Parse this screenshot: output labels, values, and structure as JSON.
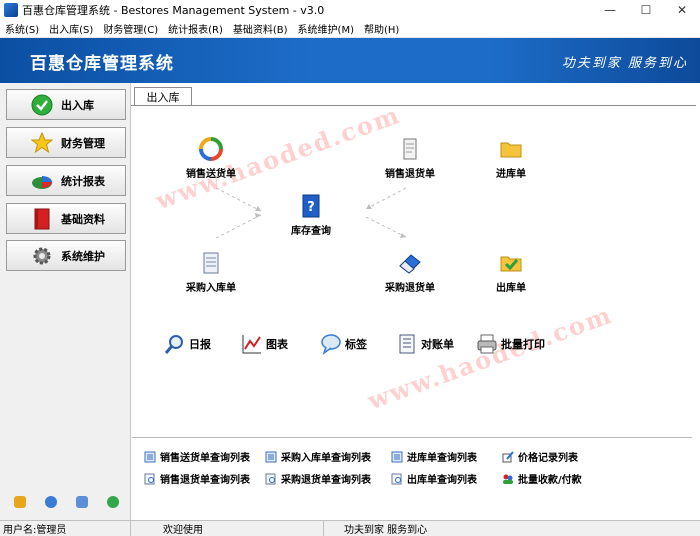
{
  "window": {
    "title": "百惠仓库管理系统 - Bestores Management System - v3.0",
    "minimize": "—",
    "maximize": "☐",
    "close": "✕"
  },
  "menu": [
    {
      "label": "系统(S)"
    },
    {
      "label": "出入库(S)"
    },
    {
      "label": "财务管理(C)"
    },
    {
      "label": "统计报表(R)"
    },
    {
      "label": "基础资料(B)"
    },
    {
      "label": "系统维护(M)"
    },
    {
      "label": "帮助(H)"
    }
  ],
  "banner": {
    "title": "百惠仓库管理系统",
    "slogan": "功夫到家 服务到心"
  },
  "sidebar": {
    "items": [
      {
        "label": "出入库",
        "icon": "check-circle-icon"
      },
      {
        "label": "财务管理",
        "icon": "star-icon"
      },
      {
        "label": "统计报表",
        "icon": "pie-chart-icon"
      },
      {
        "label": "基础资料",
        "icon": "book-icon"
      },
      {
        "label": "系统维护",
        "icon": "gear-icon"
      }
    ]
  },
  "main": {
    "tab": "出入库",
    "flow": {
      "sales_delivery": "销售送货单",
      "sales_return": "销售退货单",
      "stock_in": "进库单",
      "inventory_query": "库存查询",
      "purchase_in": "采购入库单",
      "purchase_return": "采购退货单",
      "stock_out": "出库单"
    },
    "tools": {
      "daily": "日报",
      "chart": "图表",
      "label": "标签",
      "statement": "对账单",
      "batch_print": "批量打印"
    },
    "watermark": "www.haoded.com",
    "links": {
      "row1": [
        "销售送货单查询列表",
        "采购入库单查询列表",
        "进库单查询列表",
        "价格记录列表"
      ],
      "row2": [
        "销售退货单查询列表",
        "采购退货单查询列表",
        "出库单查询列表",
        "批量收款/付款"
      ]
    }
  },
  "status": {
    "user": "用户名:管理员",
    "welcome": "欢迎使用",
    "slogan": "功夫到家 服务到心"
  }
}
